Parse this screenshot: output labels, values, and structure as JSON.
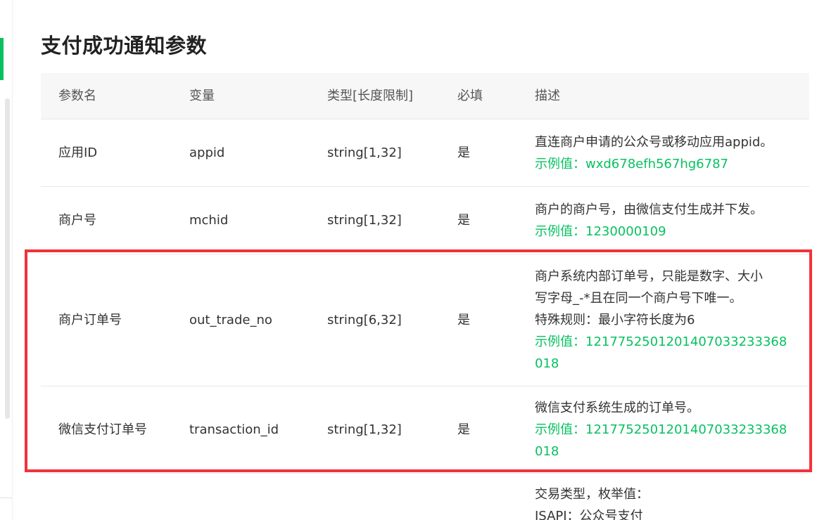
{
  "section": {
    "title": "支付成功通知参数"
  },
  "table": {
    "headers": {
      "name": "参数名",
      "variable": "变量",
      "type": "类型[长度限制]",
      "required": "必填",
      "description": "描述"
    },
    "rows": [
      {
        "name": "应用ID",
        "variable": "appid",
        "type": "string[1,32]",
        "required": "是",
        "desc_lines": [
          "直连商户申请的公众号或移动应用appid。"
        ],
        "example": "示例值：wxd678efh567hg6787"
      },
      {
        "name": "商户号",
        "variable": "mchid",
        "type": "string[1,32]",
        "required": "是",
        "desc_lines": [
          "商户的商户号，由微信支付生成并下发。"
        ],
        "example": "示例值：1230000109"
      },
      {
        "name": "商户订单号",
        "variable": "out_trade_no",
        "type": "string[6,32]",
        "required": "是",
        "desc_lines": [
          "商户系统内部订单号，只能是数字、大小",
          "写字母_-*且在同一个商户号下唯一。",
          "特殊规则：最小字符长度为6"
        ],
        "example_lines": [
          "示例值：1217752501201407033233368",
          "018"
        ]
      },
      {
        "name": "微信支付订单号",
        "variable": "transaction_id",
        "type": "string[1,32]",
        "required": "是",
        "desc_lines": [
          "微信支付系统生成的订单号。"
        ],
        "example_lines": [
          "示例值：1217752501201407033233368",
          "018"
        ]
      },
      {
        "desc_lines": [
          "交易类型，枚举值：",
          "JSAPI：公众号支付"
        ]
      }
    ]
  },
  "colors": {
    "accent_green": "#07c160",
    "highlight_red": "#f0323c",
    "header_bg": "#f7f7f7"
  }
}
